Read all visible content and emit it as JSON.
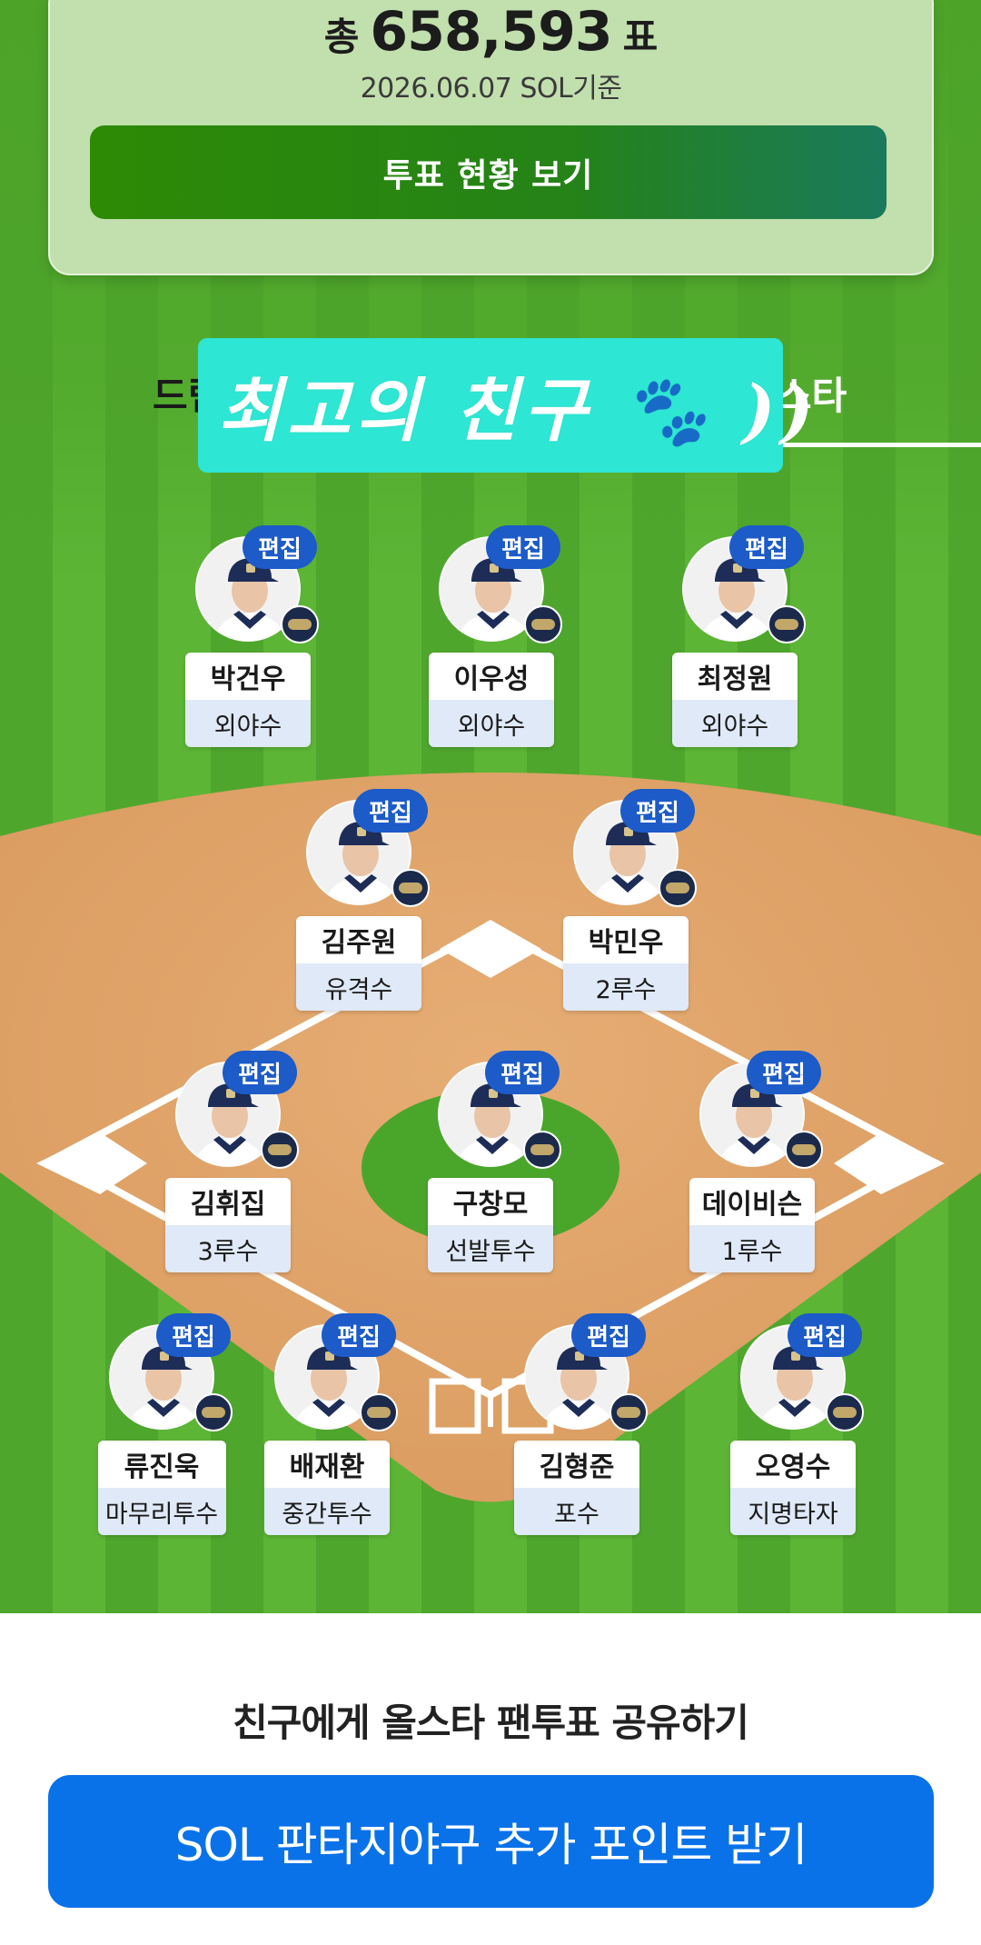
{
  "vote": {
    "prefix": "총",
    "total": "658,593",
    "suffix": "표",
    "date": "2026.06.07 SOL기준",
    "button_label": "투표 현황 보기"
  },
  "tabs": {
    "left_label": "드림",
    "right_label": "스타"
  },
  "sticker": {
    "text": "최고의 친구 🐾 ))"
  },
  "edit_label": "편집",
  "players": [
    {
      "name": "박건우",
      "position": "외야수"
    },
    {
      "name": "이우성",
      "position": "외야수"
    },
    {
      "name": "최정원",
      "position": "외야수"
    },
    {
      "name": "김주원",
      "position": "유격수"
    },
    {
      "name": "박민우",
      "position": "2루수"
    },
    {
      "name": "김휘집",
      "position": "3루수"
    },
    {
      "name": "구창모",
      "position": "선발투수"
    },
    {
      "name": "데이비슨",
      "position": "1루수"
    },
    {
      "name": "류진욱",
      "position": "마무리투수"
    },
    {
      "name": "배재환",
      "position": "중간투수"
    },
    {
      "name": "김형준",
      "position": "포수"
    },
    {
      "name": "오영수",
      "position": "지명타자"
    }
  ],
  "share": {
    "title": "친구에게 올스타 팬투표 공유하기",
    "button_label": "SOL 판타지야구 추가 포인트 받기"
  },
  "colors": {
    "accent_blue": "#0a72e8",
    "edit_badge": "#1c5bc8",
    "vote_button": "#258318",
    "field_grass": "#5cb535",
    "infield_dirt": "#e2a76c",
    "sticker_bg": "#2de6d3"
  }
}
